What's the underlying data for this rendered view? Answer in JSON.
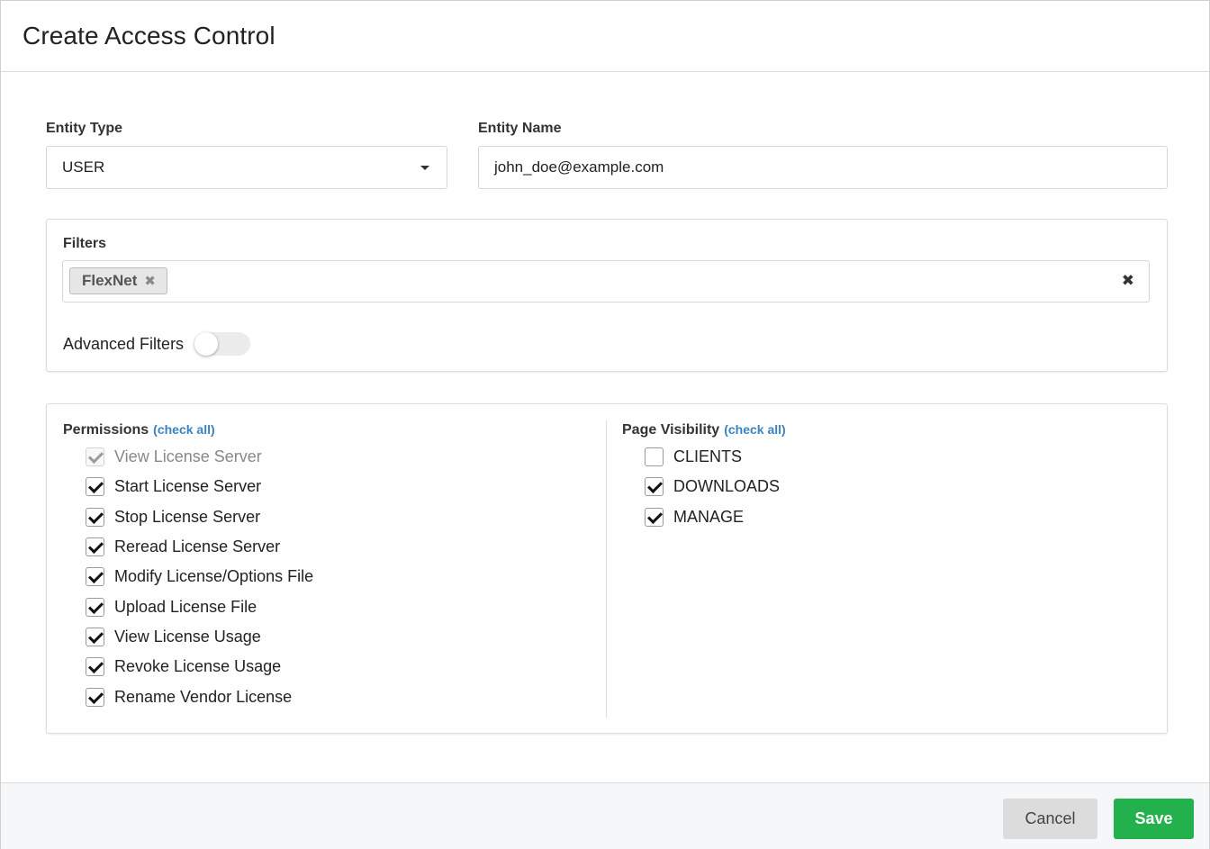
{
  "modal": {
    "title": "Create Access Control"
  },
  "entity_type": {
    "label": "Entity Type",
    "value": "USER"
  },
  "entity_name": {
    "label": "Entity Name",
    "value": "john_doe@example.com"
  },
  "filters": {
    "label": "Filters",
    "tags": [
      "FlexNet"
    ],
    "advanced_label": "Advanced Filters",
    "advanced_enabled": false
  },
  "permissions": {
    "title": "Permissions",
    "check_all": "(check all)",
    "items": [
      {
        "label": "View License Server",
        "checked": true,
        "disabled": true
      },
      {
        "label": "Start License Server",
        "checked": true,
        "disabled": false
      },
      {
        "label": "Stop License Server",
        "checked": true,
        "disabled": false
      },
      {
        "label": "Reread License Server",
        "checked": true,
        "disabled": false
      },
      {
        "label": "Modify License/Options File",
        "checked": true,
        "disabled": false
      },
      {
        "label": "Upload License File",
        "checked": true,
        "disabled": false
      },
      {
        "label": "View License Usage",
        "checked": true,
        "disabled": false
      },
      {
        "label": "Revoke License Usage",
        "checked": true,
        "disabled": false
      },
      {
        "label": "Rename Vendor License",
        "checked": true,
        "disabled": false
      }
    ]
  },
  "page_visibility": {
    "title": "Page Visibility",
    "check_all": "(check all)",
    "items": [
      {
        "label": "CLIENTS",
        "checked": false
      },
      {
        "label": "DOWNLOADS",
        "checked": true
      },
      {
        "label": "MANAGE",
        "checked": true
      }
    ]
  },
  "footer": {
    "cancel_label": "Cancel",
    "save_label": "Save"
  },
  "colors": {
    "save": "#22b14c",
    "link": "#3a83c1",
    "cancel": "#dcdcdc"
  }
}
